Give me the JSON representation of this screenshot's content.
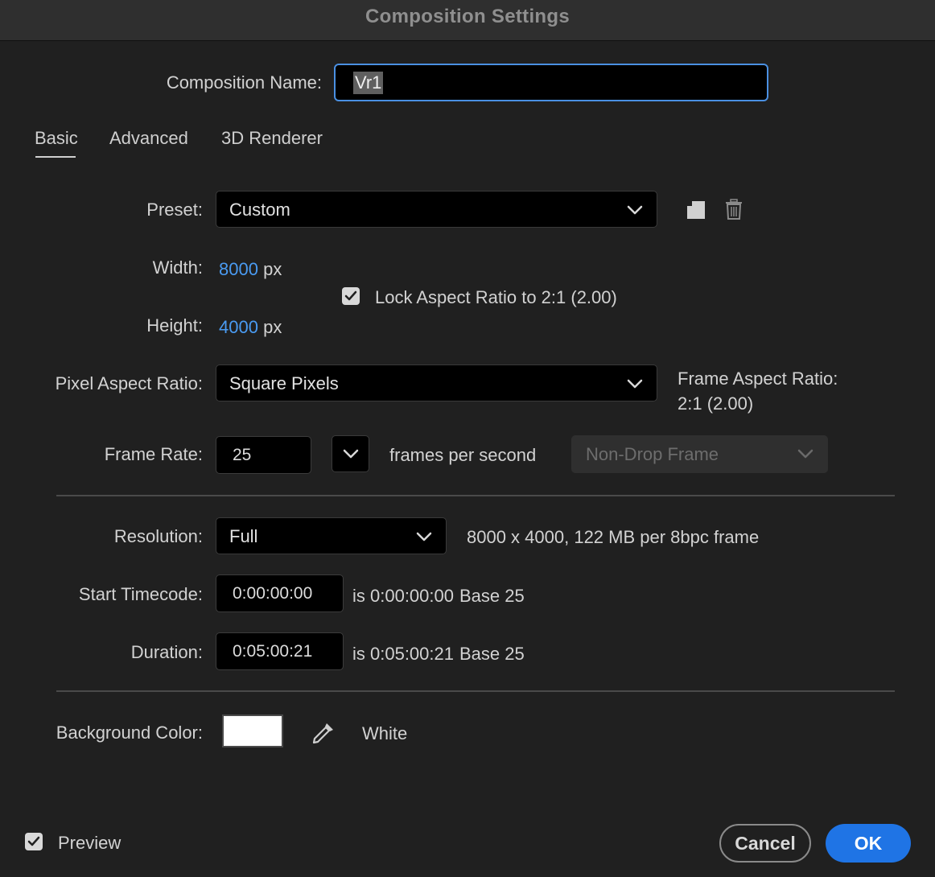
{
  "window": {
    "title": "Composition Settings"
  },
  "composition_name": {
    "label": "Composition Name:",
    "value": "Vr1"
  },
  "tabs": [
    {
      "label": "Basic",
      "active": true
    },
    {
      "label": "Advanced",
      "active": false
    },
    {
      "label": "3D Renderer",
      "active": false
    }
  ],
  "preset": {
    "label": "Preset:",
    "value": "Custom",
    "save_icon": "save-preset-icon",
    "delete_icon": "trash-icon"
  },
  "width": {
    "label": "Width:",
    "value": "8000",
    "unit": "px"
  },
  "height": {
    "label": "Height:",
    "value": "4000",
    "unit": "px"
  },
  "lock_aspect": {
    "label": "Lock Aspect Ratio to 2:1 (2.00)",
    "checked": true
  },
  "pixel_aspect": {
    "label": "Pixel Aspect Ratio:",
    "value": "Square Pixels"
  },
  "frame_aspect": {
    "label": "Frame Aspect Ratio:",
    "value": "2:1 (2.00)"
  },
  "frame_rate": {
    "label": "Frame Rate:",
    "value": "25",
    "unit": "frames per second",
    "drop_frame": "Non-Drop Frame"
  },
  "resolution": {
    "label": "Resolution:",
    "value": "Full",
    "info": "8000 x 4000, 122 MB per 8bpc frame"
  },
  "start_timecode": {
    "label": "Start Timecode:",
    "value": "0:00:00:00",
    "is_text": "is 0:00:00:00",
    "base": "Base 25"
  },
  "duration": {
    "label": "Duration:",
    "value": "0:05:00:21",
    "is_text": "is 0:05:00:21",
    "base": "Base 25"
  },
  "background": {
    "label": "Background Color:",
    "color": "#ffffff",
    "name": "White"
  },
  "preview": {
    "label": "Preview",
    "checked": true
  },
  "buttons": {
    "cancel": "Cancel",
    "ok": "OK"
  },
  "colors": {
    "accent": "#1f74e5",
    "link": "#4a9bf2",
    "background": "#202020"
  }
}
